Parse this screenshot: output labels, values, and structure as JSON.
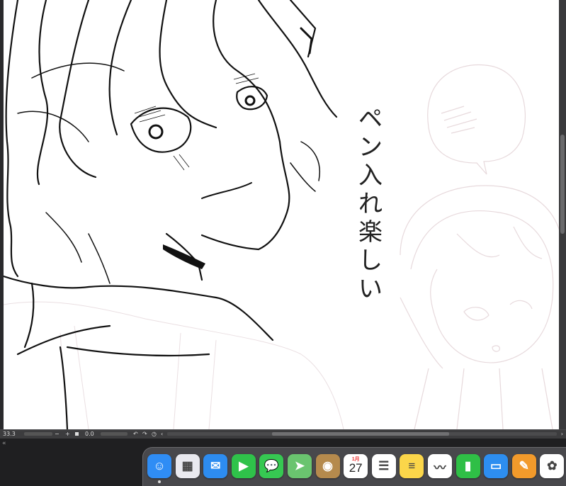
{
  "canvas": {
    "handwritten_text": [
      "ペ",
      "ン",
      "入",
      "れ",
      "楽",
      "し",
      "い"
    ]
  },
  "status_bar": {
    "zoom_value": "33.3",
    "rotation_value": "0.0",
    "zoom_minus": "−",
    "zoom_plus": "+",
    "rotate_ccw": "↶",
    "rotate_cw": "↷",
    "rotate_reset": "◷",
    "nav_left": "‹",
    "nav_right": "›",
    "panel_toggle": "«"
  },
  "dock": {
    "apps": [
      {
        "name": "Finder",
        "icon": "finder-icon",
        "color": "#2f8df5"
      },
      {
        "name": "Launchpad",
        "icon": "launchpad-icon",
        "color": "#e9e9ef"
      },
      {
        "name": "Mail",
        "icon": "mail-icon",
        "color": "#2d8cf0"
      },
      {
        "name": "FaceTime",
        "icon": "facetime-icon",
        "color": "#2fc24a"
      },
      {
        "name": "Messages",
        "icon": "messages-icon",
        "color": "#36c852"
      },
      {
        "name": "Maps",
        "icon": "maps-icon",
        "color": "#6ac46f"
      },
      {
        "name": "Contacts",
        "icon": "contacts-icon",
        "color": "#b58a4d"
      },
      {
        "name": "Calendar",
        "icon": "calendar-icon",
        "color": "#ffffff"
      },
      {
        "name": "Reminders",
        "icon": "reminders-icon",
        "color": "#ffffff"
      },
      {
        "name": "Notes",
        "icon": "notes-icon",
        "color": "#fbd64a"
      },
      {
        "name": "Freeform",
        "icon": "freeform-icon",
        "color": "#ffffff"
      },
      {
        "name": "Numbers",
        "icon": "numbers-icon",
        "color": "#2fbf46"
      },
      {
        "name": "Keynote",
        "icon": "keynote-icon",
        "color": "#2d8ef0"
      },
      {
        "name": "Pages",
        "icon": "pages-icon",
        "color": "#f29a2b"
      },
      {
        "name": "Photos",
        "icon": "photos-icon",
        "color": "#ffffff"
      }
    ],
    "calendar_month": "1月",
    "calendar_day": "27"
  }
}
